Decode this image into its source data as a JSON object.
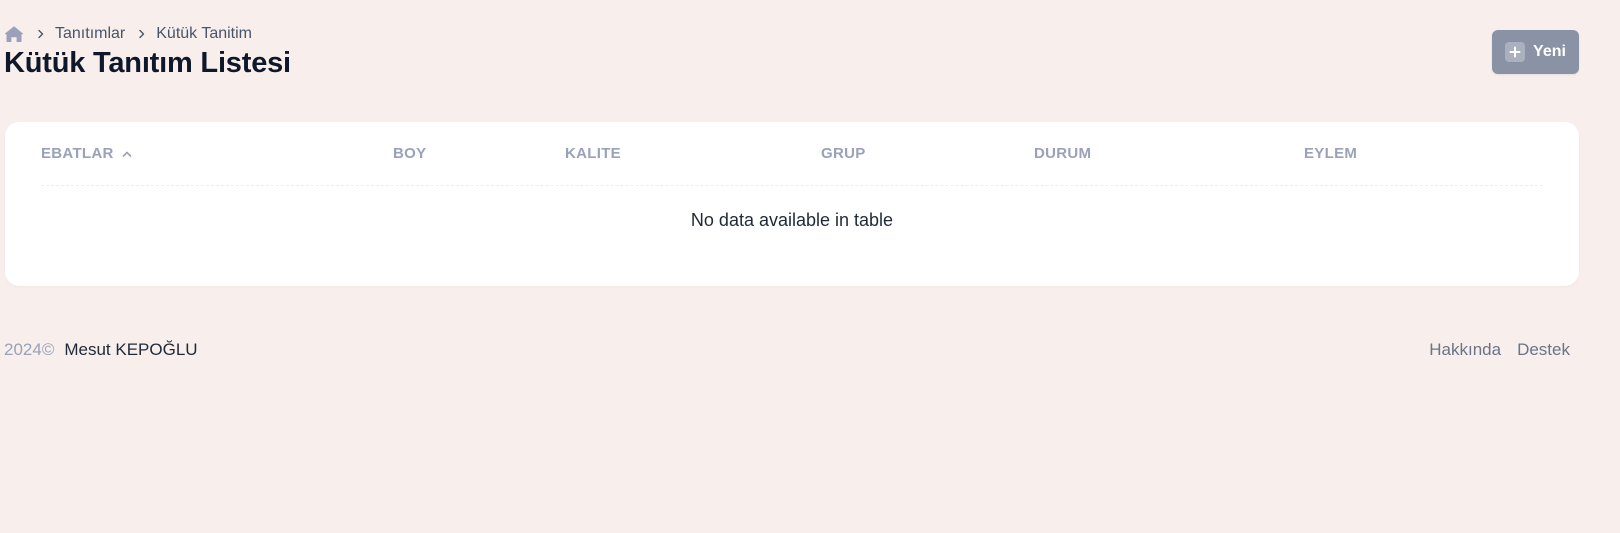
{
  "breadcrumb": {
    "home_icon": "home-icon",
    "items": [
      "Tanıtımlar",
      "Kütük Tanitim"
    ]
  },
  "page": {
    "title": "Kütük Tanıtım Listesi"
  },
  "toolbar": {
    "new_label": "Yeni",
    "new_icon": "plus-icon"
  },
  "table": {
    "columns": [
      "EBATLAR",
      "BOY",
      "KALITE",
      "GRUP",
      "DURUM",
      "EYLEM"
    ],
    "sorted_column": "EBATLAR",
    "sort_direction": "ascending",
    "rows": [],
    "empty_message": "No data available in table"
  },
  "footer": {
    "year": "2024©",
    "author": "Mesut KEPOĞLU",
    "links": [
      "Hakkında",
      "Destek"
    ]
  },
  "colors": {
    "page_background": "#f8efec",
    "button_background": "#8a92a5",
    "header_text": "#9aa1b9",
    "title_text": "#0f172a"
  }
}
